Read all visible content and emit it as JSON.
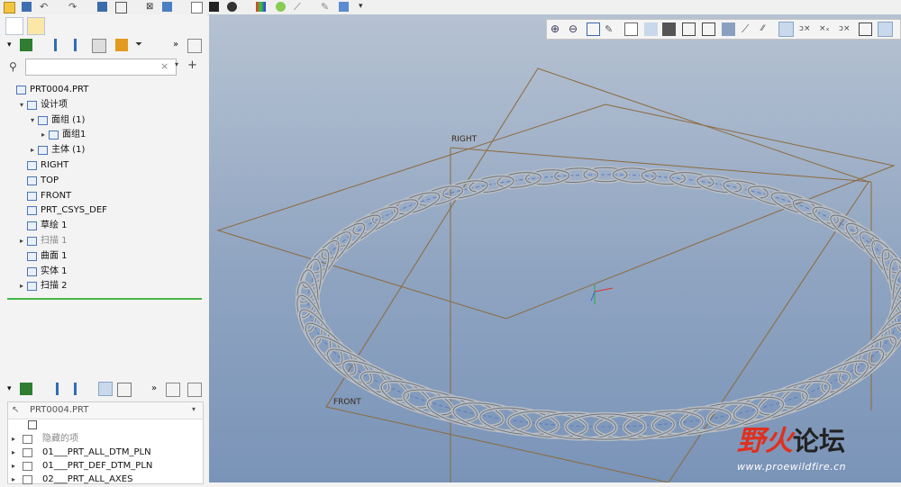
{
  "colors": {
    "accent": "#2e6db4",
    "insert_marker": "#46b646",
    "viewport_top": "#b6c2d2",
    "viewport_bottom": "#7a94b8",
    "coil": "#b9bec4",
    "datum_plane": "#8c6a3c",
    "watermark_red": "#e0301e"
  },
  "quick_access_icons": [
    "new-icon",
    "open-icon",
    "save-icon",
    "undo-icon",
    "redo-icon",
    "regenerate-icon",
    "windows-icon",
    "close-window-icon",
    "model-tree-icon",
    "display-icon",
    "appearance-icon",
    "color-icon",
    "render-icon",
    "measure-icon",
    "select-icon",
    "customize-icon"
  ],
  "model_tree": {
    "filter_placeholder": "",
    "items": [
      {
        "label": "PRT0004.PRT",
        "icon": "part-icon",
        "depth": 0,
        "expander": ""
      },
      {
        "label": "设计项",
        "icon": "design-items-icon",
        "depth": 1,
        "expander": "▾"
      },
      {
        "label": "面组 (1)",
        "icon": "quilt-group-icon",
        "depth": 2,
        "expander": "▾"
      },
      {
        "label": "面组1",
        "icon": "quilt-icon",
        "depth": 3,
        "expander": "▸"
      },
      {
        "label": "主体 (1)",
        "icon": "body-icon",
        "depth": 2,
        "expander": "▸"
      },
      {
        "label": "RIGHT",
        "icon": "datum-plane-icon",
        "depth": 1,
        "expander": ""
      },
      {
        "label": "TOP",
        "icon": "datum-plane-icon",
        "depth": 1,
        "expander": ""
      },
      {
        "label": "FRONT",
        "icon": "datum-plane-icon",
        "depth": 1,
        "expander": ""
      },
      {
        "label": "PRT_CSYS_DEF",
        "icon": "csys-icon",
        "depth": 1,
        "expander": ""
      },
      {
        "label": "草绘 1",
        "icon": "sketch-icon",
        "depth": 1,
        "expander": ""
      },
      {
        "label": "扫描 1",
        "icon": "sweep-icon",
        "depth": 1,
        "expander": "▸",
        "dim": true
      },
      {
        "label": "曲面 1",
        "icon": "surface-icon",
        "depth": 1,
        "expander": ""
      },
      {
        "label": "实体 1",
        "icon": "solid-icon",
        "depth": 1,
        "expander": ""
      },
      {
        "label": "扫描 2",
        "icon": "sweep-icon",
        "depth": 1,
        "expander": "▸"
      }
    ]
  },
  "layer_tree": {
    "model": "PRT0004.PRT",
    "items": [
      {
        "label": "隐藏的项",
        "dim": true
      },
      {
        "label": "01___PRT_ALL_DTM_PLN"
      },
      {
        "label": "01___PRT_DEF_DTM_PLN"
      },
      {
        "label": "02___PRT_ALL_AXES"
      }
    ]
  },
  "viewport": {
    "datum_labels": {
      "right": "RIGHT",
      "front": "FRONT"
    },
    "watermark": {
      "title_red": "野火",
      "title_dark": "论坛",
      "url": "www.proewildfire.cn"
    }
  }
}
